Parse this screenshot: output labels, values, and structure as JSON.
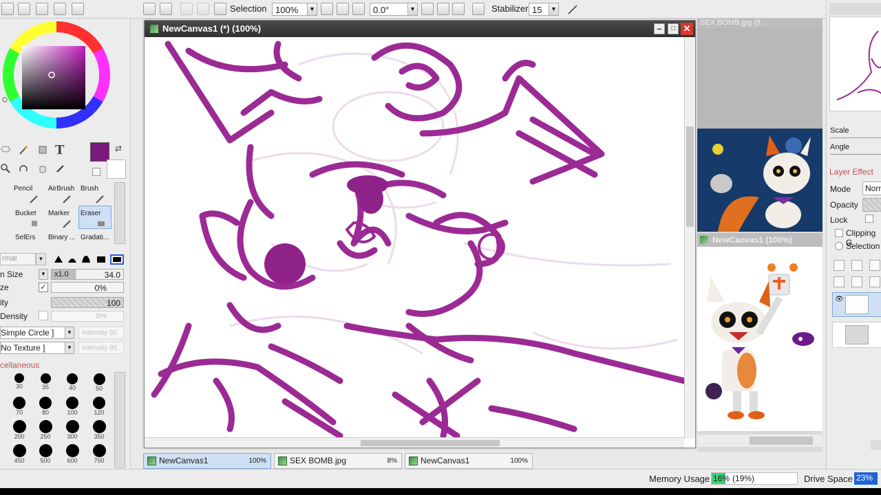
{
  "toolbar": {
    "selection_label": "Selection",
    "zoom_value": "100%",
    "angle_value": "0.0°",
    "stabilizer_label": "Stabilizer",
    "stabilizer_value": "15"
  },
  "canvas_window": {
    "title": "NewCanvas1 (*) (100%)"
  },
  "color": {
    "primary": "#7a1a7a",
    "secondary": "#ffffff"
  },
  "tools": {
    "row1": [
      "Pencil",
      "AirBrush",
      "Brush"
    ],
    "row2": [
      "Bucket",
      "Marker",
      "Eraser"
    ],
    "row3": [
      "SelErs",
      "Binary ...",
      "Gradati..."
    ],
    "selected": "Eraser"
  },
  "brush_settings": {
    "mode_label": "rmal",
    "size_label": "n Size",
    "size_multiplier": "x1.0",
    "size_value": "34.0",
    "min_size_label": "ze",
    "min_size_value": "0%",
    "density_label": "ity",
    "density_value": "100",
    "min_density_label": "Density",
    "min_density_value": "0%",
    "shape": "Simple Circle ]",
    "shape_intensity": "Intensity 50",
    "texture": "No Texture ]",
    "texture_intensity": "Intensity 95",
    "misc_label": "cellaneous"
  },
  "brush_sizes": [
    "30",
    "35",
    "40",
    "50",
    "70",
    "80",
    "100",
    "120",
    "200",
    "250",
    "300",
    "350",
    "450",
    "500",
    "600",
    "700"
  ],
  "navigator": {
    "ref_title": "SEX BOMB.jpg (8...",
    "canvas_title": "NewCanvas1 (100%)"
  },
  "right_panel": {
    "scale_label": "Scale",
    "angle_label": "Angle",
    "layer_effect_label": "Layer Effect",
    "mode_label": "Mode",
    "mode_value": "Norm",
    "opacity_label": "Opacity",
    "lock_label": "Lock",
    "clipping_label": "Clipping G",
    "selection_label": "Selection"
  },
  "tabs": [
    {
      "name": "NewCanvas1",
      "pct": "100%"
    },
    {
      "name": "SEX BOMB.jpg",
      "pct": "8%"
    },
    {
      "name": "NewCanvas1",
      "pct": "100%"
    }
  ],
  "status": {
    "memory_label": "Memory Usage",
    "memory_value": "16%",
    "memory_extra": "(19%)",
    "memory_fraction": 0.16,
    "drive_label": "Drive Space",
    "drive_value": "23%"
  }
}
